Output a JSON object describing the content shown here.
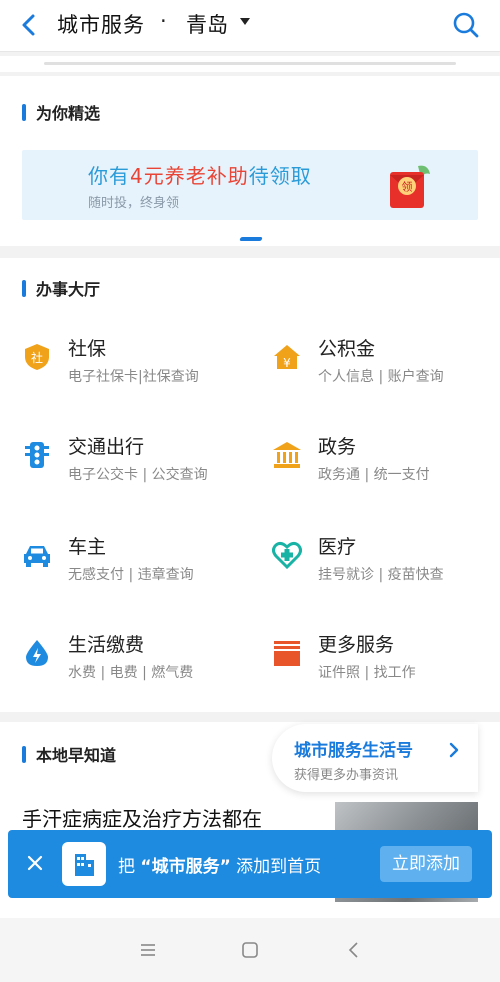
{
  "header": {
    "title": "城市服务",
    "separator": "·",
    "city": "青岛"
  },
  "featured": {
    "section_title": "为你精选",
    "banner": {
      "title_pre": "你有",
      "title_highlight": "4元养老补助",
      "title_post": "待领取",
      "subtitle": "随时投，终身领",
      "envelope_text": "领"
    }
  },
  "hall": {
    "section_title": "办事大厅",
    "services": [
      {
        "name": "社保",
        "desc": "电子社保卡|社保查询",
        "icon": "social-security-icon",
        "glyph": "社"
      },
      {
        "name": "公积金",
        "desc": "个人信息 | 账户查询",
        "icon": "housing-fund-icon",
        "glyph": "¥"
      },
      {
        "name": "交通出行",
        "desc": "电子公交卡 | 公交查询",
        "icon": "traffic-light-icon"
      },
      {
        "name": "政务",
        "desc": "政务通 | 统一支付",
        "icon": "government-icon"
      },
      {
        "name": "车主",
        "desc": "无感支付 | 违章查询",
        "icon": "car-icon"
      },
      {
        "name": "医疗",
        "desc": "挂号就诊 | 疫苗快查",
        "icon": "medical-icon"
      },
      {
        "name": "生活缴费",
        "desc": "水费 | 电费 | 燃气费",
        "icon": "utility-payment-icon"
      },
      {
        "name": "更多服务",
        "desc": "证件照 | 找工作",
        "icon": "more-services-icon"
      }
    ]
  },
  "local": {
    "section_title": "本地早知道",
    "life_card": {
      "title": "城市服务生活号",
      "subtitle": "获得更多办事资讯"
    },
    "news_title": "手汗症病症及治疗方法都在"
  },
  "add_bar": {
    "text_pre": "把",
    "text_quoted": "“城市服务”",
    "text_post": "添加到首页",
    "button": "立即添加"
  },
  "colors": {
    "accent": "#1a7bdc",
    "orange": "#f0a21a",
    "add_bar": "#1f8be0"
  }
}
